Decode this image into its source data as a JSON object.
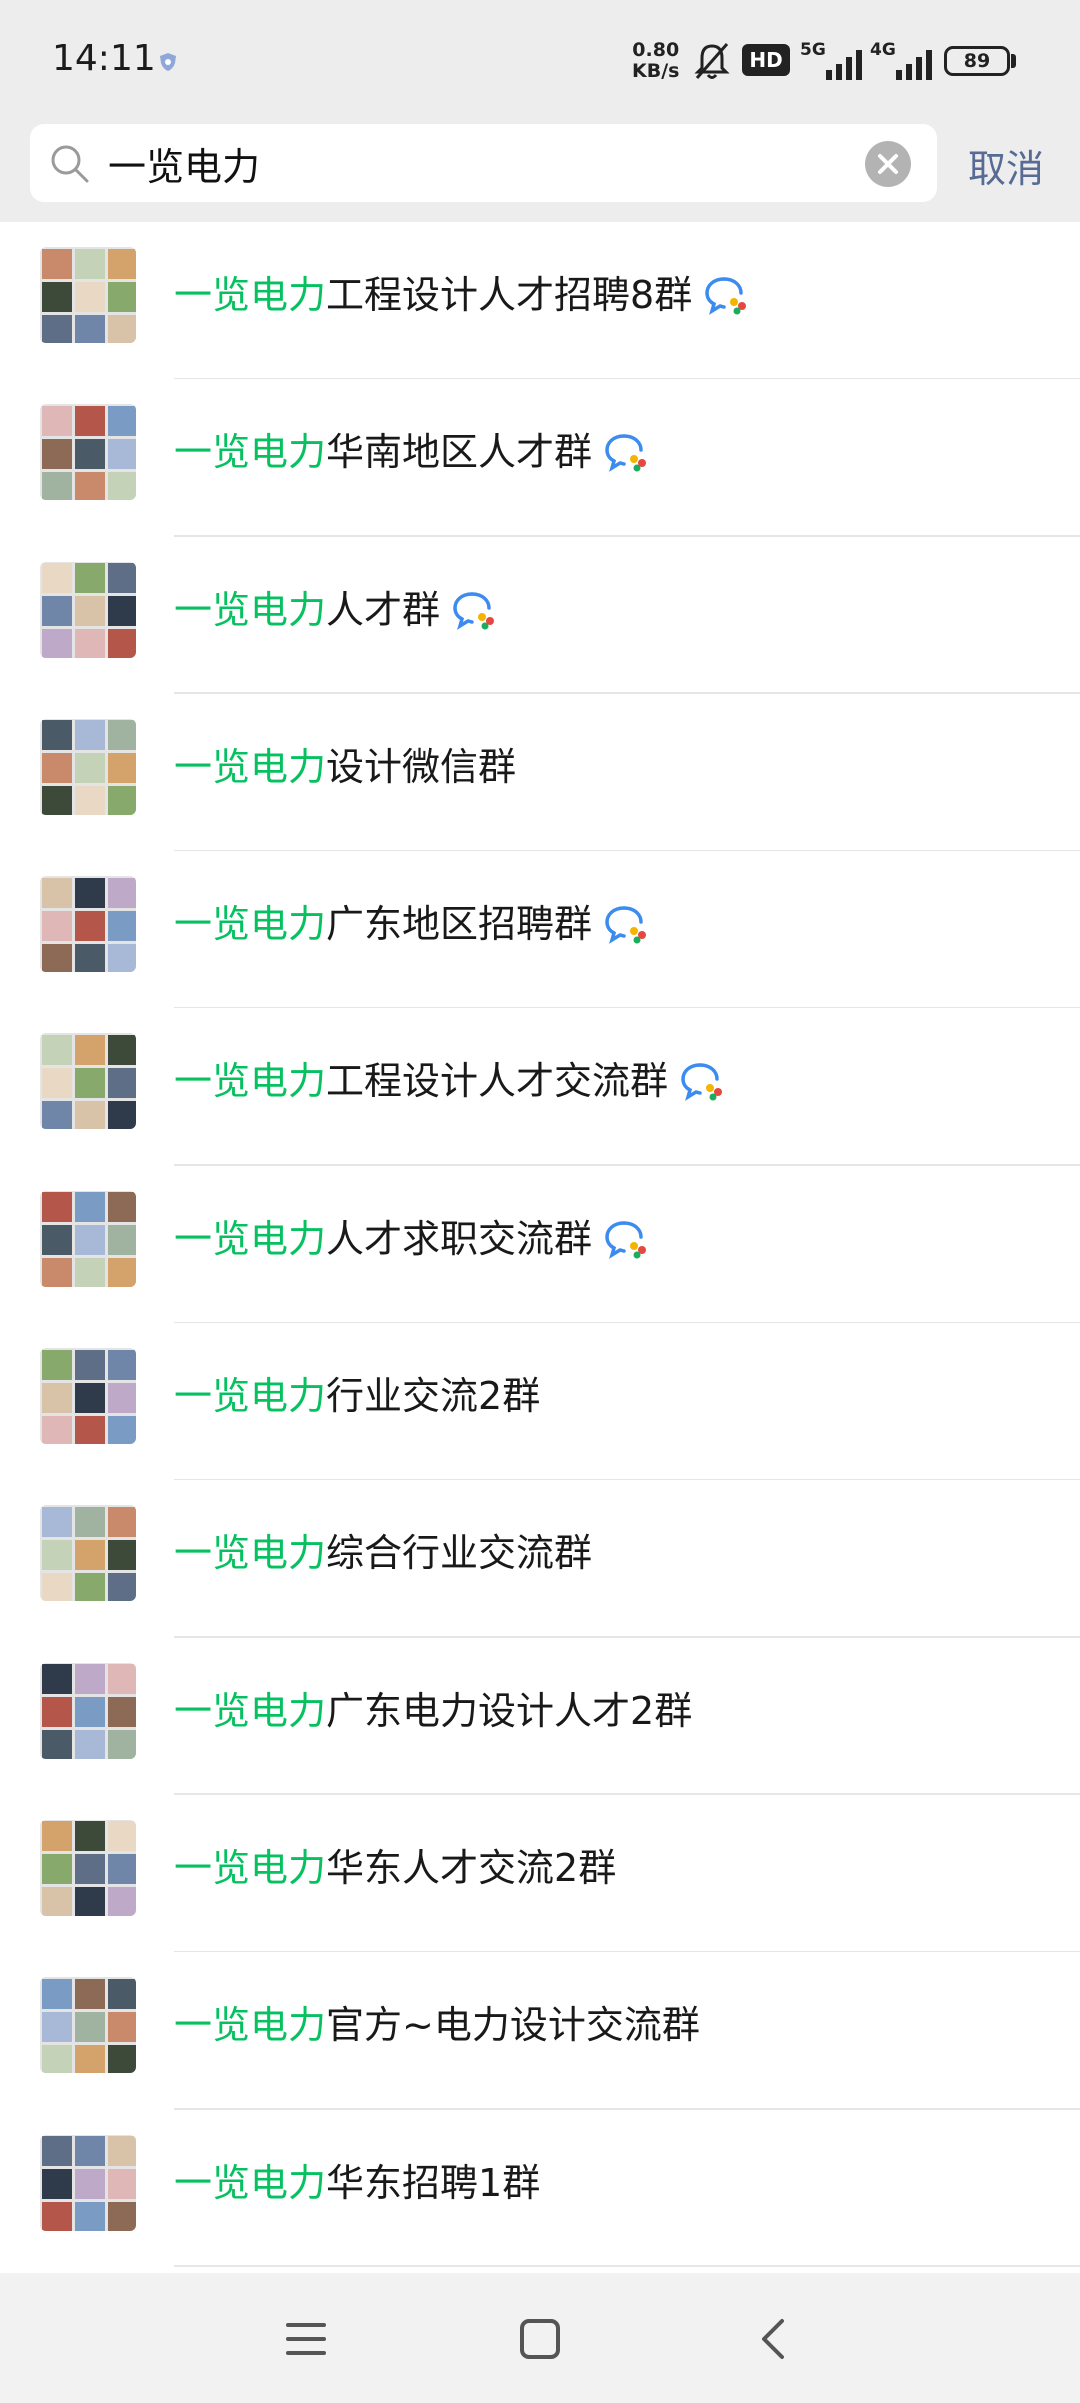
{
  "status_bar": {
    "time": "14:11",
    "net_speed_value": "0.80",
    "net_speed_unit": "KB/s",
    "hd_badge": "HD",
    "signal_1_label": "5G",
    "signal_2_label": "4G",
    "battery": "89"
  },
  "search": {
    "query": "一览电力",
    "cancel_label": "取消"
  },
  "results": [
    {
      "keyword": "一览电力",
      "rest": "工程设计人才招聘8群",
      "enterprise_badge": true
    },
    {
      "keyword": "一览电力",
      "rest": "华南地区人才群",
      "enterprise_badge": true
    },
    {
      "keyword": "一览电力",
      "rest": "人才群",
      "enterprise_badge": true
    },
    {
      "keyword": "一览电力",
      "rest": "设计微信群",
      "enterprise_badge": false
    },
    {
      "keyword": "一览电力",
      "rest": "广东地区招聘群",
      "enterprise_badge": true
    },
    {
      "keyword": "一览电力",
      "rest": "工程设计人才交流群",
      "enterprise_badge": true
    },
    {
      "keyword": "一览电力",
      "rest": "人才求职交流群",
      "enterprise_badge": true
    },
    {
      "keyword": "一览电力",
      "rest": "行业交流2群",
      "enterprise_badge": false
    },
    {
      "keyword": "一览电力",
      "rest": "综合行业交流群",
      "enterprise_badge": false
    },
    {
      "keyword": "一览电力",
      "rest": "广东电力设计人才2群",
      "enterprise_badge": false
    },
    {
      "keyword": "一览电力",
      "rest": "华东人才交流2群",
      "enterprise_badge": false
    },
    {
      "keyword": "一览电力",
      "rest": "官方~电力设计交流群",
      "enterprise_badge": false
    },
    {
      "keyword": "一览电力",
      "rest": "华东招聘1群",
      "enterprise_badge": false
    }
  ],
  "colors": {
    "keyword_highlight": "#07c160",
    "cancel_link": "#576b95",
    "header_background": "#ededed"
  },
  "nav_bar": {
    "icons": [
      "menu-icon",
      "home-icon",
      "back-icon"
    ]
  }
}
